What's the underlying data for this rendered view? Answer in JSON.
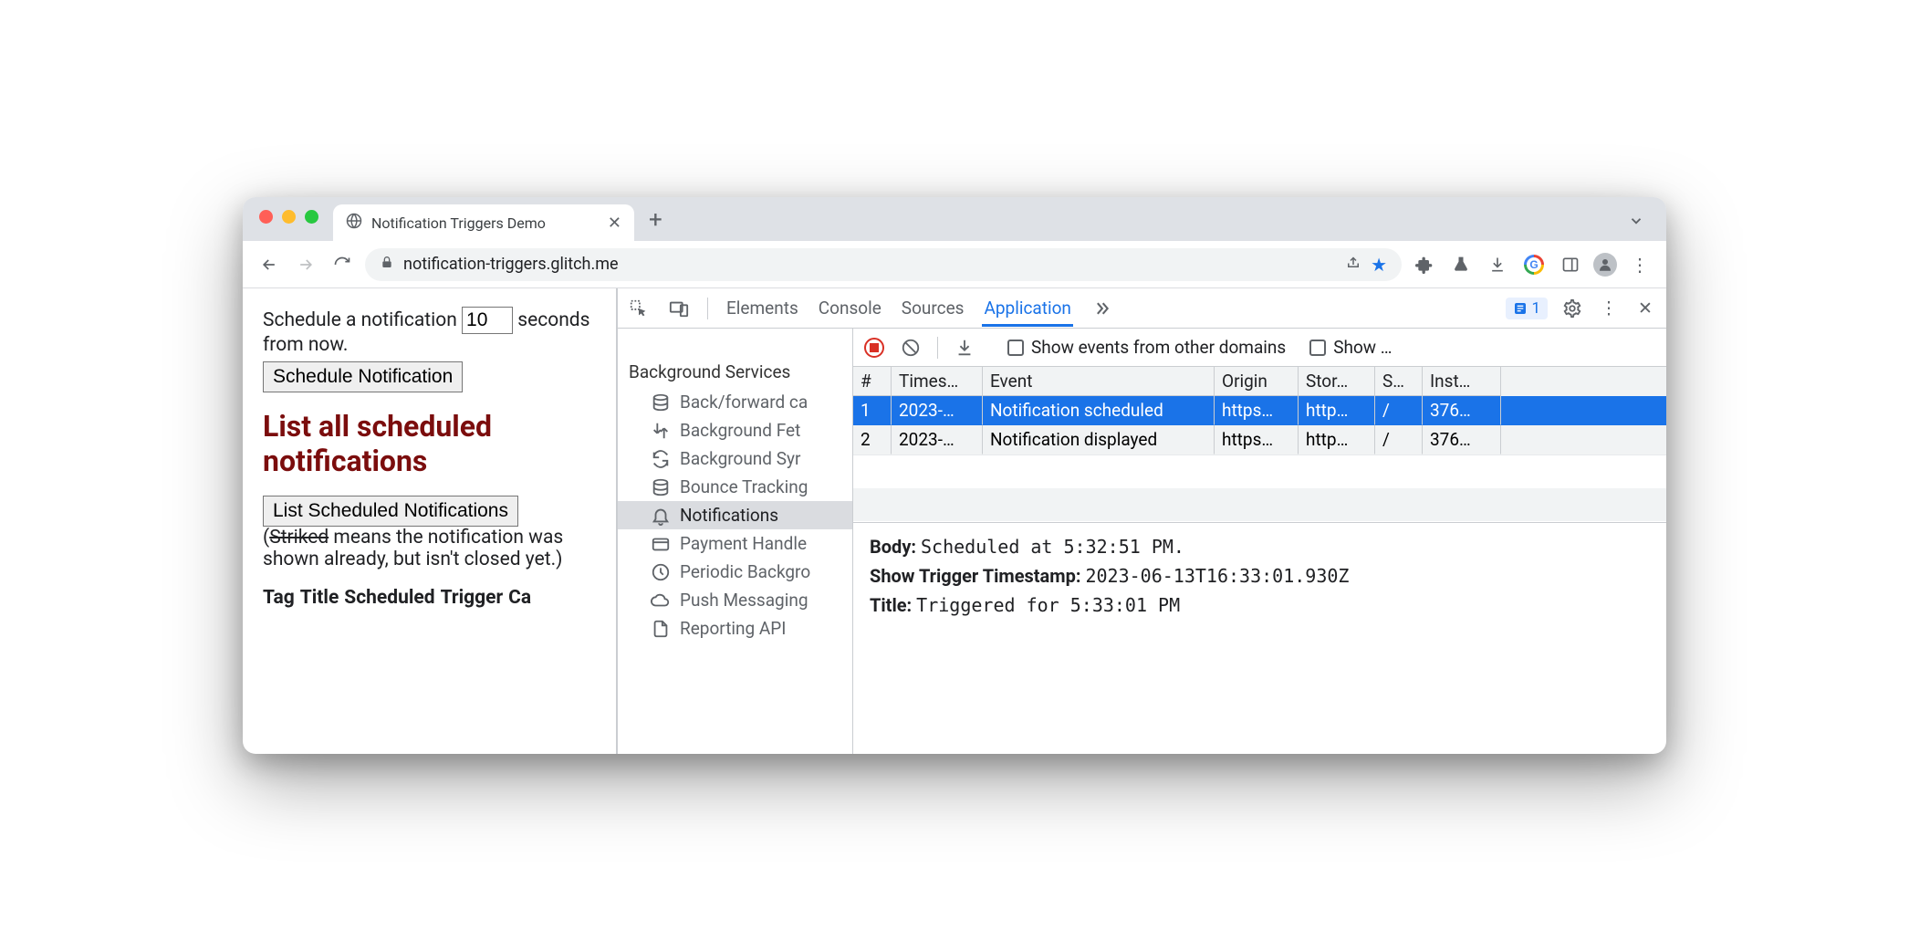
{
  "browser": {
    "tab_title": "Notification Triggers Demo",
    "url": "notification-triggers.glitch.me"
  },
  "page": {
    "schedule_pre": "Schedule a notification",
    "schedule_value": "10",
    "schedule_post": "seconds from now.",
    "schedule_btn": "Schedule Notification",
    "heading": "List all scheduled notifications",
    "list_btn": "List Scheduled Notifications",
    "note_open": "(",
    "note_struck": "Striked",
    "note_rest": " means the notification was shown already, but isn't closed yet.)",
    "cols": [
      "Tag",
      "Title",
      "Scheduled",
      "Trigger",
      "Ca"
    ]
  },
  "devtools": {
    "tabs": [
      "Elements",
      "Console",
      "Sources",
      "Application"
    ],
    "active_tab": "Application",
    "issues_count": "1",
    "sidebar": {
      "header": "Background Services",
      "items": [
        {
          "label": "Back/forward ca"
        },
        {
          "label": "Background Fet"
        },
        {
          "label": "Background Syr"
        },
        {
          "label": "Bounce Tracking"
        },
        {
          "label": "Notifications",
          "active": true
        },
        {
          "label": "Payment Handle"
        },
        {
          "label": "Periodic Backgro"
        },
        {
          "label": "Push Messaging"
        },
        {
          "label": "Reporting API"
        }
      ]
    },
    "toolbar2": {
      "show_events_label": "Show events from other domains",
      "show_label": "Show …"
    },
    "table": {
      "headers": [
        "#",
        "Times…",
        "Event",
        "Origin",
        "Stor…",
        "S…",
        "Inst…"
      ],
      "rows": [
        {
          "n": "1",
          "ts": "2023-…",
          "ev": "Notification scheduled",
          "or": "https…",
          "st": "http…",
          "sw": "/",
          "in": "376…",
          "sel": true
        },
        {
          "n": "2",
          "ts": "2023-…",
          "ev": "Notification displayed",
          "or": "https…",
          "st": "http…",
          "sw": "/",
          "in": "376…",
          "sel": false
        }
      ]
    },
    "details": {
      "body_k": "Body:",
      "body_v": "Scheduled at 5:32:51 PM.",
      "ts_k": "Show Trigger Timestamp:",
      "ts_v": "2023-06-13T16:33:01.930Z",
      "title_k": "Title:",
      "title_v": "Triggered for 5:33:01 PM"
    }
  }
}
